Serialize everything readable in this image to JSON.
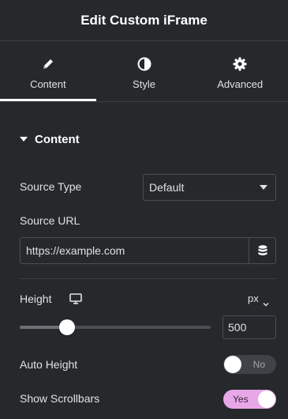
{
  "header": {
    "title": "Edit Custom iFrame"
  },
  "tabs": [
    {
      "label": "Content",
      "icon": "pencil-icon",
      "active": true
    },
    {
      "label": "Style",
      "icon": "half-circle-icon",
      "active": false
    },
    {
      "label": "Advanced",
      "icon": "gear-icon",
      "active": false
    }
  ],
  "section": {
    "title": "Content",
    "expanded": true
  },
  "source_type": {
    "label": "Source Type",
    "value": "Default"
  },
  "source_url": {
    "label": "Source URL",
    "value": "https://example.com",
    "dynamic_icon": "database-icon"
  },
  "height": {
    "label": "Height",
    "device_icon": "desktop-icon",
    "unit": "px",
    "value": "500",
    "slider_fraction": 0.246
  },
  "auto_height": {
    "label": "Auto Height",
    "state": "No",
    "on": false
  },
  "show_scrollbars": {
    "label": "Show Scrollbars",
    "state": "Yes",
    "on": true
  },
  "colors": {
    "background": "#26292c",
    "text": "#e0e1e3",
    "switch_on": "#e8a8e8",
    "switch_off": "#3f4247"
  }
}
